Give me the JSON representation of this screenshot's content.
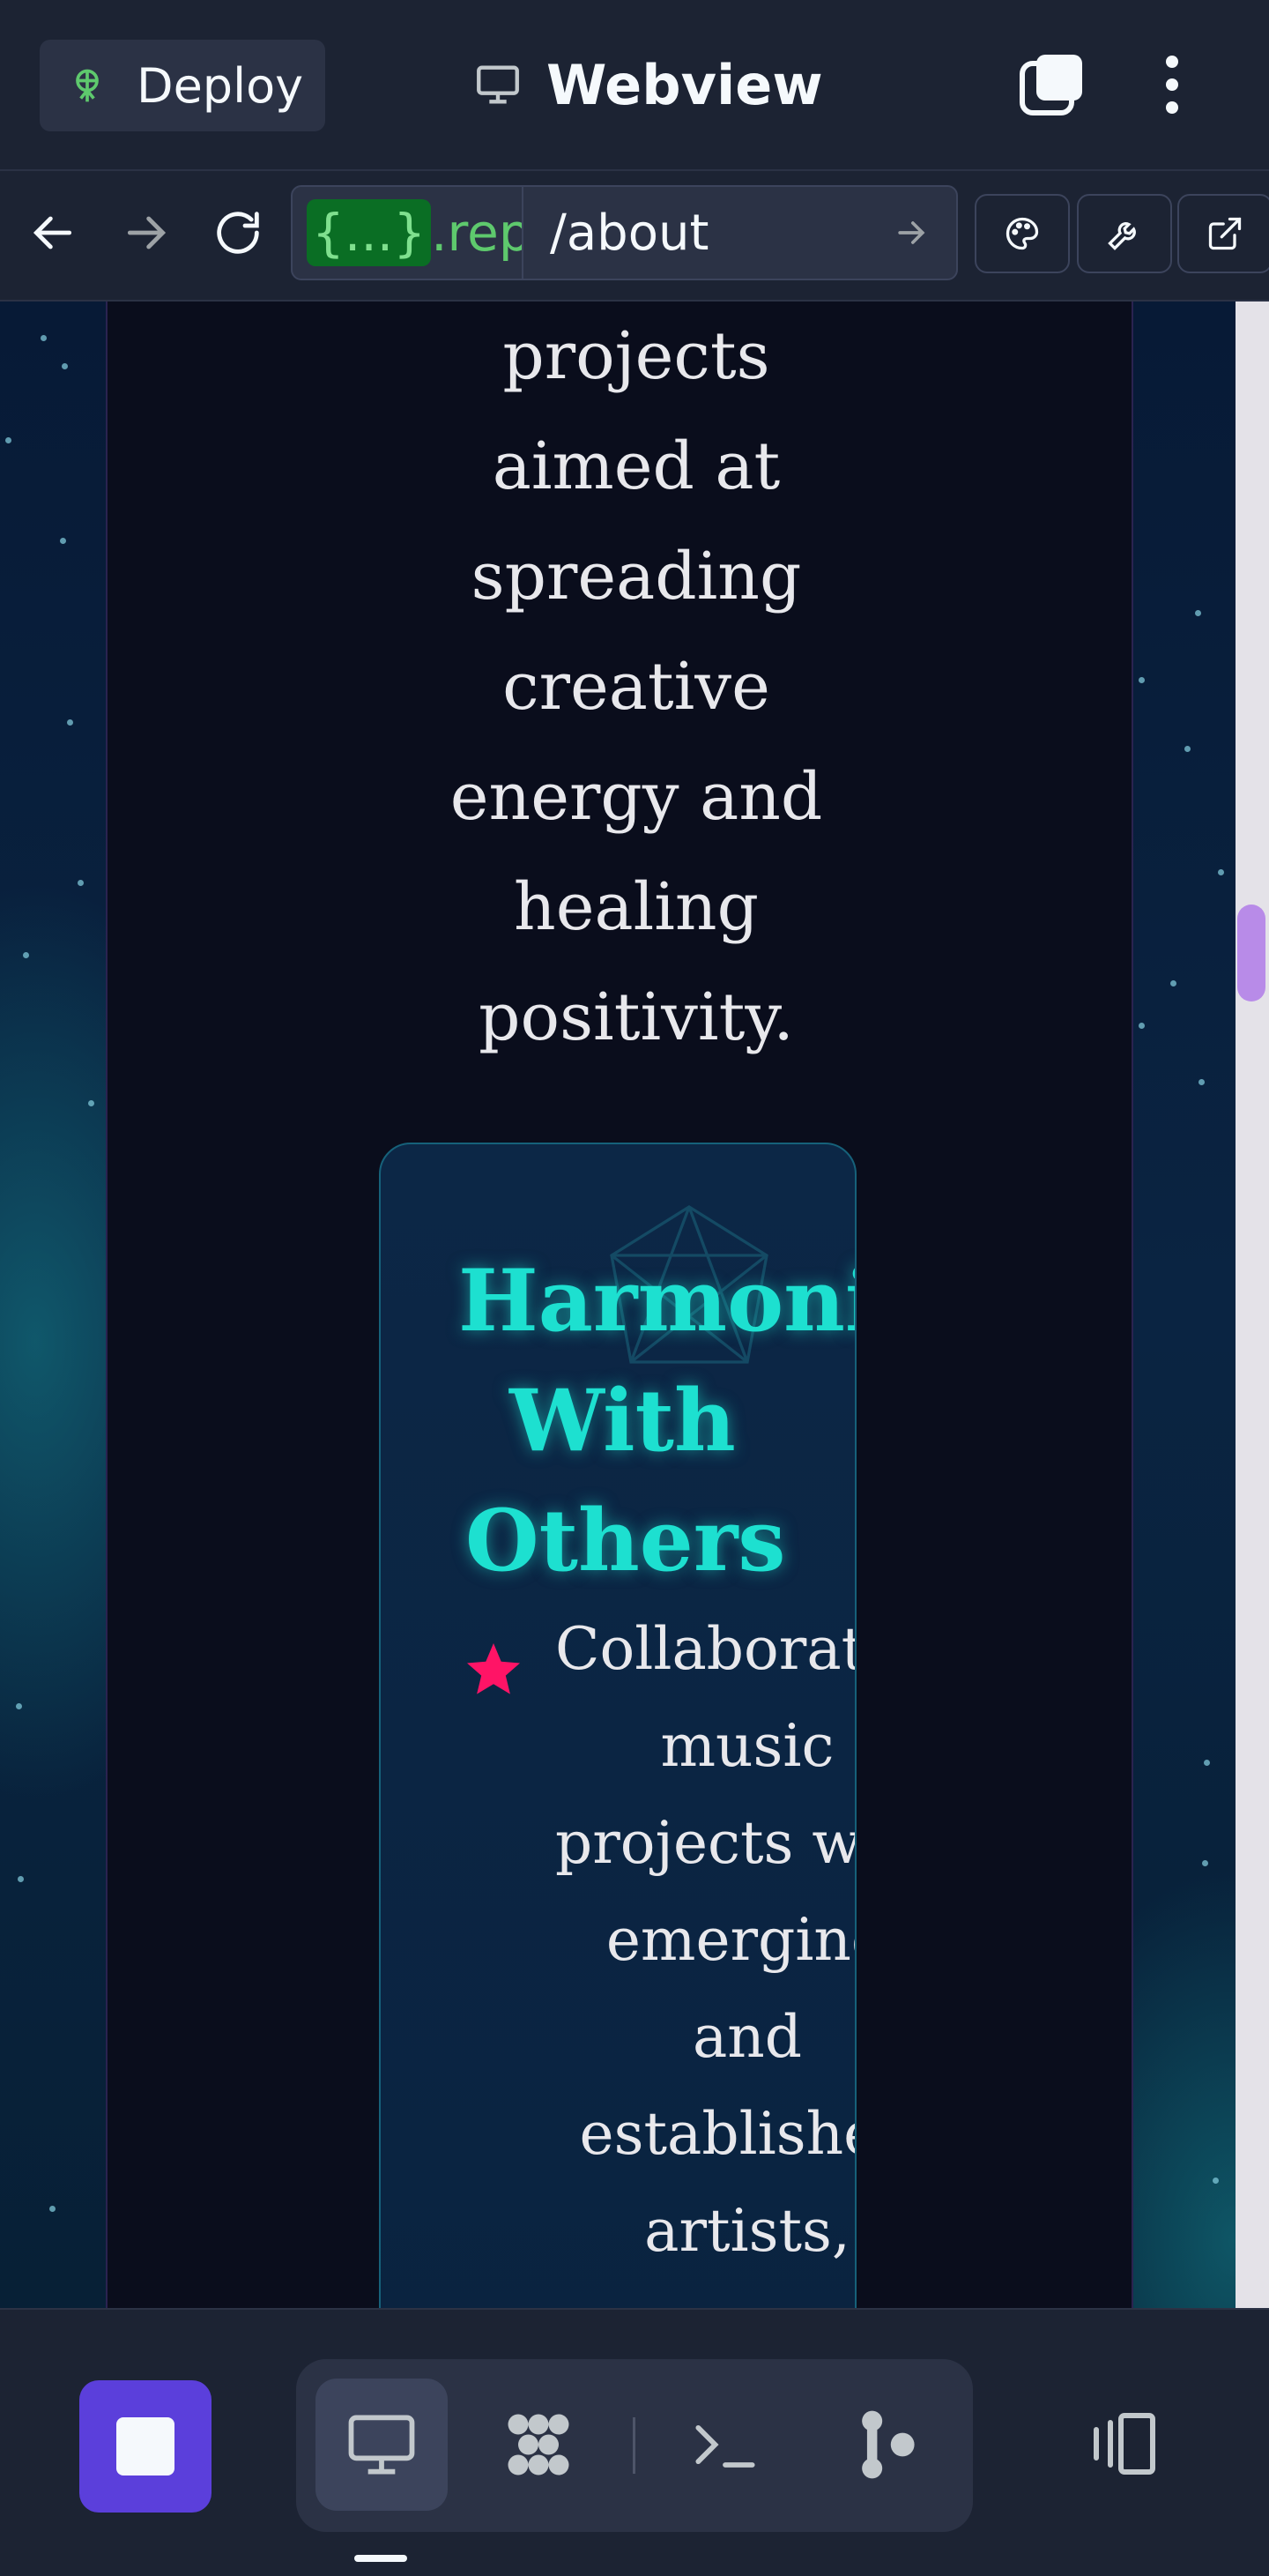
{
  "topbar": {
    "deploy_label": "Deploy",
    "title": "Webview",
    "icons": [
      "deploy-icon",
      "monitor-icon",
      "tabs-icon",
      "more-vertical-icon"
    ]
  },
  "urlbar": {
    "host_braces": "{...}",
    "host_rest": ".repl",
    "path": "/about",
    "nav_icons": [
      "back-arrow-icon",
      "forward-arrow-icon",
      "reload-icon"
    ],
    "tools": [
      "palette-icon",
      "wrench-icon",
      "external-link-icon"
    ]
  },
  "content": {
    "intro_lines": [
      "projects",
      "aimed at",
      "spreading",
      "creative",
      "energy and",
      "healing",
      "positivity."
    ],
    "card": {
      "title_lines": [
        "Harmonizing",
        "With",
        "Others"
      ],
      "bullet_lines": [
        "Collaborative",
        "music",
        "projects with",
        "emerging",
        "and",
        "established",
        "artists,"
      ]
    }
  },
  "bottombar": {
    "tabs": [
      "monitor-icon",
      "packager-icon",
      "terminal-icon",
      "git-icon"
    ],
    "icons": [
      "stop-icon",
      "panel-toggle-icon"
    ]
  },
  "colors": {
    "accent_purple": "#5b3fdb",
    "card_title": "#1de0d0",
    "bullet_star": "#ff1466",
    "scroll_thumb": "#b88be8"
  }
}
